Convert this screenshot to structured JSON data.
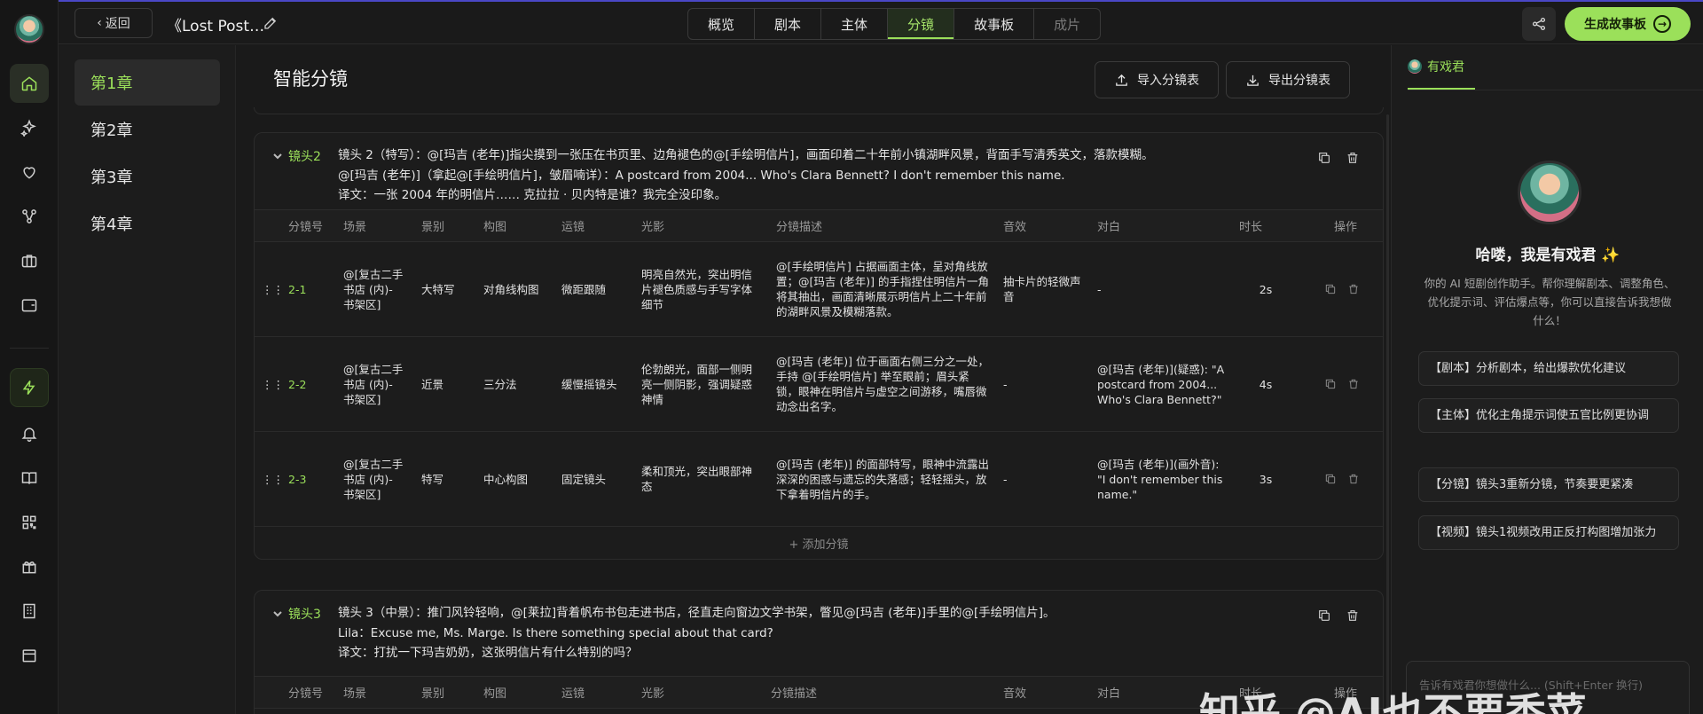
{
  "topbar": {
    "back_label": "返回",
    "doc_title": "《Lost Post…",
    "tabs": [
      "概览",
      "剧本",
      "主体",
      "分镜",
      "故事板",
      "成片"
    ],
    "generate_label": "生成故事板"
  },
  "chapters": [
    "第1章",
    "第2章",
    "第3章",
    "第4章"
  ],
  "main": {
    "title": "智能分镜",
    "import_label": "导入分镜表",
    "export_label": "导出分镜表",
    "add_row_label": "+ 添加分镜"
  },
  "columns": [
    "分镜号",
    "场景",
    "景别",
    "构图",
    "运镜",
    "光影",
    "分镜描述",
    "音效",
    "对白",
    "时长",
    "操作"
  ],
  "shots": [
    {
      "tag": "镜头2",
      "lines": [
        "镜头 2（特写）：@[玛吉 (老年)]指尖摸到一张压在书页里、边角褪色的@[手绘明信片]，画面印着二十年前小镇湖畔风景，背面手写清秀英文，落款模糊。",
        "@[玛吉 (老年)]（拿起@[手绘明信片]，皱眉喃详）：A postcard from 2004... Who's Clara Bennett? I don't remember this name.",
        "译文：一张 2004 年的明信片…… 克拉拉 · 贝内特是谁？我完全没印象。"
      ],
      "rows": [
        {
          "no": "2-1",
          "scene": "@[复古二手书店 (内)- 书架区]",
          "shot": "大特写",
          "comp": "对角线构图",
          "move": "微距跟随",
          "light": "明亮自然光，突出明信片褪色质感与手写字体细节",
          "desc": "@[手绘明信片] 占据画面主体，呈对角线放置；@[玛吉 (老年)] 的手指捏住明信片一角将其抽出，画面清晰展示明信片上二十年前的湖畔风景及模糊落款。",
          "sfx": "抽卡片的轻微声音",
          "dialog": "-",
          "dur": "2s"
        },
        {
          "no": "2-2",
          "scene": "@[复古二手书店 (内)- 书架区]",
          "shot": "近景",
          "comp": "三分法",
          "move": "缓慢摇镜头",
          "light": "伦勃朗光，面部一侧明亮一侧阴影，强调疑惑神情",
          "desc": "@[玛吉 (老年)] 位于画面右侧三分之一处，手持 @[手绘明信片] 举至眼前；眉头紧锁，眼神在明信片与虚空之间游移，嘴唇微动念出名字。",
          "sfx": "-",
          "dialog": "@[玛吉 (老年)](疑惑): \"A postcard from 2004... Who's Clara Bennett?\"",
          "dur": "4s"
        },
        {
          "no": "2-3",
          "scene": "@[复古二手书店 (内)- 书架区]",
          "shot": "特写",
          "comp": "中心构图",
          "move": "固定镜头",
          "light": "柔和顶光，突出眼部神态",
          "desc": "@[玛吉 (老年)] 的面部特写，眼神中流露出深深的困惑与遗忘的失落感；轻轻摇头，放下拿着明信片的手。",
          "sfx": "-",
          "dialog": "@[玛吉 (老年)](画外音): \"I don't remember this name.\"",
          "dur": "3s"
        }
      ]
    },
    {
      "tag": "镜头3",
      "lines": [
        "镜头 3（中景）：推门风铃轻响，@[莱拉]背着帆布书包走进书店，径直走向窗边文学书架，瞥见@[玛吉 (老年)]手里的@[手绘明信片]。",
        "Lila：Excuse me, Ms. Marge. Is there something special about that card?",
        "译文：打扰一下玛吉奶奶，这张明信片有什么特别的吗？"
      ]
    }
  ],
  "assistant": {
    "tab_label": "有戏君",
    "hello": "哈喽，我是有戏君",
    "spark": "✨",
    "desc": "你的 AI 短剧创作助手。帮你理解剧本、调整角色、优化提示词、评估爆点等，你可以直接告诉我想做什么！",
    "suggestions": [
      "【剧本】分析剧本，给出爆款优化建议",
      "【主体】优化主角提示词使五官比例更协调",
      "【分镜】镜头3重新分镜，节奏要更紧凑",
      "【视频】镜头1视频改用正反打构图增加张力"
    ],
    "input_placeholder": "告诉有戏君你想做什么... (Shift+Enter 换行)"
  },
  "watermark": "知乎 @AI也不要香菜"
}
